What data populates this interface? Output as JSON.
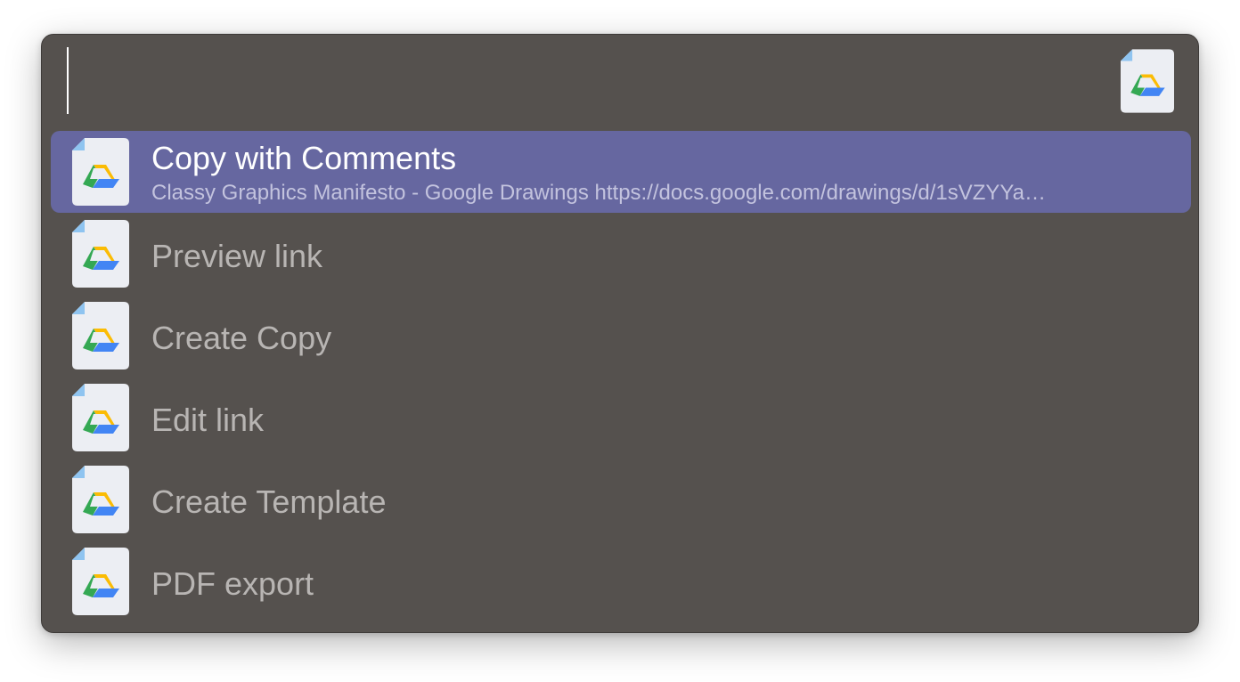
{
  "search": {
    "value": "",
    "placeholder": "",
    "icon": "google-drive-file-icon"
  },
  "results": [
    {
      "title": "Copy with Comments",
      "subtitle": "Classy Graphics Manifesto - Google Drawings https://docs.google.com/drawings/d/1sVZYYa…",
      "icon": "google-drive-file-icon",
      "selected": true
    },
    {
      "title": "Preview link",
      "icon": "google-drive-file-icon",
      "selected": false
    },
    {
      "title": "Create Copy",
      "icon": "google-drive-file-icon",
      "selected": false
    },
    {
      "title": "Edit link",
      "icon": "google-drive-file-icon",
      "selected": false
    },
    {
      "title": "Create Template",
      "icon": "google-drive-file-icon",
      "selected": false
    },
    {
      "title": "PDF export",
      "icon": "google-drive-file-icon",
      "selected": false
    }
  ],
  "colors": {
    "window_background": "#55514e",
    "selection": "#6667a0",
    "title_text": "#b8b5b3",
    "selected_title_text": "#ffffff",
    "subtitle_text": "#c3c3de"
  }
}
